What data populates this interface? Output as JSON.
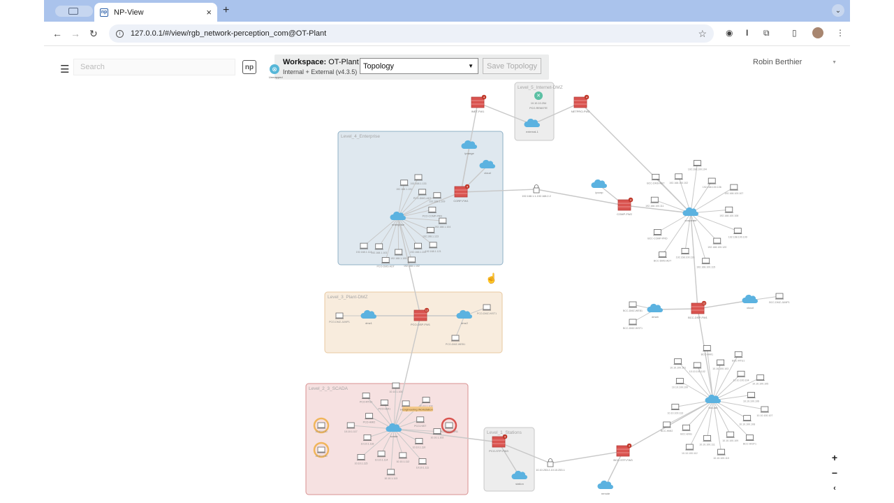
{
  "browser": {
    "tab_title": "NP-View",
    "tab_favicon": "np",
    "url": "127.0.0.1/#/view/rgb_network-perception_com@OT-Plant",
    "new_tab_label": "+",
    "close_tab_label": "×",
    "icons": [
      "back-icon",
      "forward-icon",
      "reload-icon",
      "info-icon",
      "star-icon",
      "extensions-icon",
      "sidebar-icon",
      "menu-icon"
    ]
  },
  "app": {
    "search_placeholder": "Search",
    "logo_text": "np",
    "workspace_label": "Workspace:",
    "workspace_name": "OT-Plant",
    "workspace_subtitle": "Internal + External (v4.3.5)",
    "workspace_icon_label": "Unmapped",
    "view_select_value": "Topology",
    "save_button": "Save Topology",
    "user_name": "Robin Berthier"
  },
  "zoom": {
    "in": "+",
    "out": "−",
    "collapse": "‹"
  },
  "colors": {
    "firewall": "#d9534f",
    "cloud": "#5bb2e0",
    "enterprise_zone": "#dfe8ef",
    "dmz_zone": "#f8ecdd",
    "scada_zone": "#f6e1e1",
    "gray_zone": "#eeeeee",
    "edge": "#c8c8c8"
  },
  "zones": [
    {
      "id": "z-internet-dmz",
      "label": "Level_5_Internet-DMZ",
      "type": "gray"
    },
    {
      "id": "z-enterprise",
      "label": "Level_4_Enterprise",
      "type": "enterprise"
    },
    {
      "id": "z-plant-dmz",
      "label": "Level_3_Plant-DMZ",
      "type": "dmz"
    },
    {
      "id": "z-scada",
      "label": "Level_2_3_SCADA",
      "type": "scada"
    },
    {
      "id": "z-stations",
      "label": "Level_1_Stations",
      "type": "gray"
    }
  ],
  "nodes": {
    "fw_inet": {
      "label": "INET-FW1",
      "kind": "firewall",
      "badge": "4"
    },
    "fw_netpro": {
      "label": "NETPRO-FW2",
      "kind": "firewall",
      "badge": "4"
    },
    "router_dmz": {
      "label": "10.10.10.254",
      "kind": "router"
    },
    "dmz_host": {
      "label": "PCO-REMOTE",
      "kind": "text"
    },
    "cloud_dmz": {
      "label": "external-1",
      "kind": "cloud"
    },
    "cloud_ent_a": {
      "label": "iprange",
      "kind": "cloud"
    },
    "cloud_ent_b": {
      "label": "cloud",
      "kind": "cloud"
    },
    "fw_corp": {
      "label": "CORP-FW1",
      "kind": "firewall",
      "badge": "4"
    },
    "cloud_ent_hub": {
      "label": "enterprise",
      "kind": "cloud"
    },
    "lock_mid": {
      "label": "192.168.1.1-192.168.2.2",
      "kind": "lock"
    },
    "cloud_mid": {
      "label": "ipcorp",
      "kind": "cloud"
    },
    "fw_comp": {
      "label": "COMP-FW2",
      "kind": "firewall",
      "badge": "4"
    },
    "cloud_corp_hub": {
      "label": "corporate",
      "kind": "cloud"
    },
    "fw_dmz": {
      "label": "PCO-DSP-FW1",
      "kind": "firewall",
      "badge": "12"
    },
    "cloud_dmz_a": {
      "label": "dmz1",
      "kind": "cloud"
    },
    "cloud_dmz_b": {
      "label": "dmz2",
      "kind": "cloud"
    },
    "fw_bcc": {
      "label": "BCC-DSP-FW1",
      "kind": "firewall",
      "badge": "12"
    },
    "cloud_bcc_a": {
      "label": "dmzb",
      "kind": "cloud"
    },
    "cloud_bcc_b": {
      "label": "cloud",
      "kind": "cloud"
    },
    "cloud_scada": {
      "label": "scada",
      "kind": "cloud"
    },
    "fw_station": {
      "label": "PCO-STP-FW3",
      "kind": "firewall",
      "badge": "4"
    },
    "cloud_station": {
      "label": "station",
      "kind": "cloud"
    },
    "lock_low": {
      "label": "10.10.253.2-10.10.253.1",
      "kind": "lock"
    },
    "fw_bcc_low": {
      "label": "BCC-STP-FW3",
      "kind": "firewall",
      "badge": "4"
    },
    "cloud_bcc_low": {
      "label": "remote",
      "kind": "cloud"
    },
    "cloud_bcc_hub": {
      "label": "bcc-lan",
      "kind": "cloud"
    },
    "cloud_bottom": {
      "label": "remote",
      "kind": "cloud"
    }
  },
  "hosts": {
    "enterprise": [
      "192.168.1.131",
      "192.168.1.133",
      "PCO-DMG-ADT",
      "192.168.1.109",
      "PCO-COMP-PRD",
      "192.168.1.104",
      "192.168.1.123",
      "192.168.1.121",
      "192.168.1.101",
      "192.168.1.102",
      "192.168.1.105",
      "PCO-DMS-ADT",
      "192.168.1.103",
      "192.168.1.114"
    ],
    "corporate": [
      "192.168.100.111",
      "BCC-DMS-ADT",
      "192.168.100.102",
      "192.168.100.104",
      "192.168.100.106",
      "192.168.100.107",
      "192.168.100.108",
      "192.168.100.109",
      "192.168.100.120",
      "192.168.100.115",
      "192.168.100.116",
      "BCC-DMS-ADT",
      "BCC-COMP-PRD"
    ],
    "plant_dmz": [
      "PCO-DMZ-JUMP1",
      "PCO-DMZ-HIST1",
      "PCO-DMZ-WEB1"
    ],
    "bcc_dmz": [
      "BCC-DMZ-WEB1",
      "BCC-DMZ-HIST1",
      "BCC-DMZ-JUMP1"
    ],
    "scada": [
      "PCO-HMI1",
      "10.10.1.100",
      "PCO-ENG",
      "10.10.1.103",
      "PCO-HIST",
      "10.10.1.102",
      "10.10.1.110",
      "10.10.1.111",
      "10.10.1.112",
      "10.10.1.113",
      "10.10.1.114",
      "10.10.1.115",
      "10.10.1.116",
      "10.10.1.117",
      "PCO-HMI2",
      "PCO-RTU1"
    ],
    "scada_labels": {
      "tag": "Engineering Workstation",
      "left_ring_a": "10.10.1.20",
      "left_ring_b": "10.10.1.30",
      "right_ring": "PCO-ENG-WS1"
    },
    "bcc": [
      "10.10.100.100",
      "10.10.100.101",
      "10.10.100.102",
      "BCC-HMI1",
      "10.10.100.103",
      "BCC-RTU1",
      "10.10.100.104",
      "10.10.100.105",
      "10.10.100.106",
      "10.10.100.107",
      "10.10.100.108",
      "BCC-HIST1",
      "10.10.100.109",
      "10.10.100.110",
      "10.10.100.111",
      "10.10.100.112",
      "BCC-ENG",
      "BCC-HMI2",
      "10.10.100.113"
    ]
  }
}
